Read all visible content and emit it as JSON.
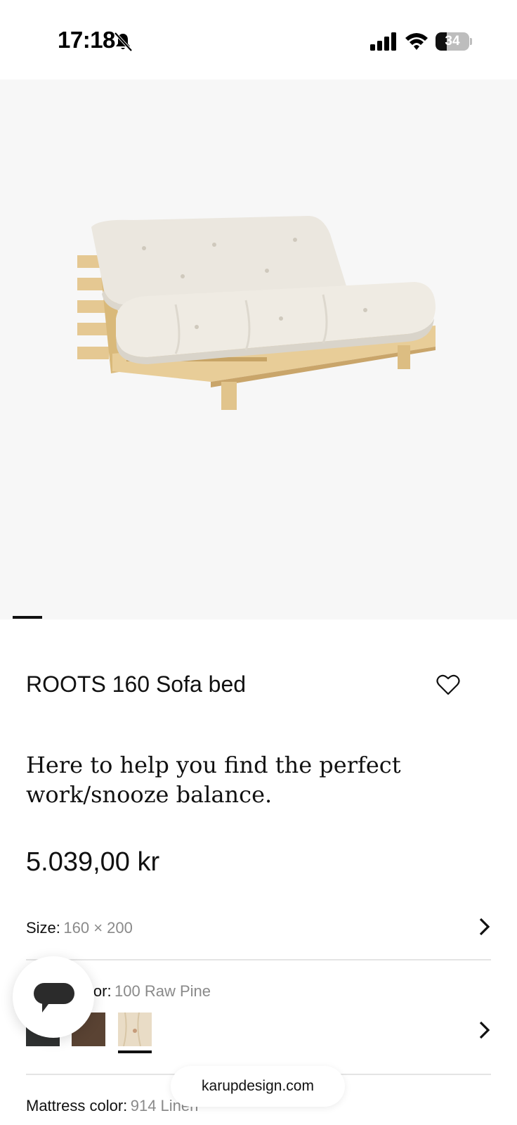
{
  "status_bar": {
    "time": "17:18",
    "battery_level": "34",
    "battery_fraction": 0.34
  },
  "gallery": {
    "image_alt": "ROOTS 160 Sofa bed",
    "current_index": 1
  },
  "product": {
    "title": "ROOTS 160 Sofa bed",
    "tagline": "Here to help you find the perfect work/snooze balance.",
    "price": "5.039,00 kr"
  },
  "options": {
    "size": {
      "label": "Size:",
      "value": "160 × 200"
    },
    "frame_color": {
      "label": "lor:",
      "value": "100 Raw Pine"
    },
    "mattress_color": {
      "label": "Mattress color:",
      "value": "914 Linen"
    }
  },
  "swatches": [
    {
      "name": "dark",
      "color": "#2f3131"
    },
    {
      "name": "brown",
      "color": "#5a4333"
    },
    {
      "name": "raw-pine",
      "color": "#e9dcc6",
      "selected": true
    }
  ],
  "browser": {
    "url": "karupdesign.com"
  },
  "icons": {
    "bell": "bell-slash-icon",
    "signal": "signal-icon",
    "wifi": "wifi-icon",
    "heart": "heart-icon",
    "chevron": "chevron-right-icon",
    "chat": "chat-bubble-icon"
  }
}
